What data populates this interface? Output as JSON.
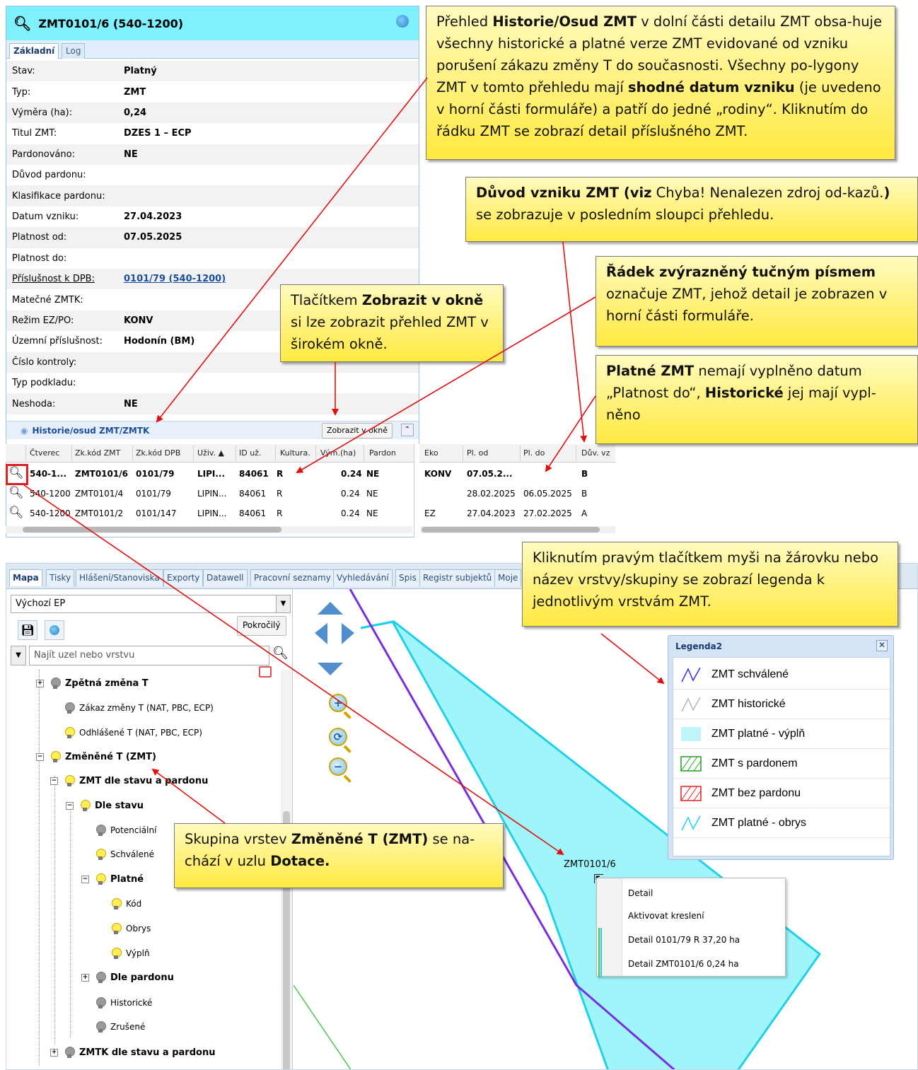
{
  "detail": {
    "title": "ZMT0101/6 (540-1200)",
    "tabs": [
      "Základní",
      "Log"
    ],
    "fields": [
      {
        "label": "Stav:",
        "value": "Platný"
      },
      {
        "label": "Typ:",
        "value": "ZMT"
      },
      {
        "label": "Výměra (ha):",
        "value": "0,24"
      },
      {
        "label": "Titul ZMT:",
        "value": "DZES 1 – ECP"
      },
      {
        "label": "Pardonováno:",
        "value": "NE"
      },
      {
        "label": "Důvod pardonu:",
        "value": ""
      },
      {
        "label": "Klasifikace pardonu:",
        "value": ""
      },
      {
        "label": "Datum vzniku:",
        "value": "27.04.2023"
      },
      {
        "label": "Platnost od:",
        "value": "07.05.2025"
      },
      {
        "label": "Platnost do:",
        "value": ""
      },
      {
        "label": "Příslušnost k DPB:",
        "value": "0101/79 (540-1200)"
      },
      {
        "label": "Matečné ZMTK:",
        "value": ""
      },
      {
        "label": "Režim EZ/PO:",
        "value": "KONV"
      },
      {
        "label": "Územní příslušnost:",
        "value": "Hodonín (BM)"
      },
      {
        "label": "Číslo kontroly:",
        "value": ""
      },
      {
        "label": "Typ podkladu:",
        "value": ""
      },
      {
        "label": "Neshoda:",
        "value": "NE"
      }
    ],
    "history_title": "Historie/osud ZMT/ZMTK",
    "window_button": "Zobrazit v okně"
  },
  "grid": {
    "headers": [
      "Čtverec",
      "Zk.kód ZMT",
      "Zk.kód DPB",
      "Uživ. ▲",
      "ID už.",
      "Kultura.",
      "Vým.(ha)",
      "Pardon",
      "Eko",
      "Pl. od",
      "Pl. do",
      "Dův. vz"
    ],
    "rows": [
      {
        "ctverec": "540-1...",
        "zmt": "ZMT0101/6",
        "dpb": "0101/79",
        "uziv": "LIPI...",
        "id": "84061",
        "kultura": "R",
        "vym": "0.24",
        "pardon": "NE",
        "eko": "KONV",
        "od": "07.05.2...",
        "do": "",
        "duv": "B",
        "bold": true
      },
      {
        "ctverec": "540-1200",
        "zmt": "ZMT0101/4",
        "dpb": "0101/79",
        "uziv": "LIPIN...",
        "id": "84061",
        "kultura": "R",
        "vym": "0.24",
        "pardon": "NE",
        "eko": "",
        "od": "28.02.2025",
        "do": "06.05.2025",
        "duv": "B",
        "bold": false
      },
      {
        "ctverec": "540-1200",
        "zmt": "ZMT0101/2",
        "dpb": "0101/147",
        "uziv": "LIPIN...",
        "id": "84061",
        "kultura": "R",
        "vym": "0.24",
        "pardon": "NE",
        "eko": "EZ",
        "od": "27.04.2023",
        "do": "27.02.2025",
        "duv": "A",
        "bold": false
      }
    ]
  },
  "app": {
    "tabs": [
      "Mapa",
      "Tisky",
      "Hlášení/Stanoviska",
      "Exporty",
      "Datawell",
      "Pracovní seznamy",
      "Vyhledávání",
      "Spis",
      "Registr subjektů",
      "Moje"
    ],
    "ep_select": "Výchozí EP",
    "advanced_button": "Pokročilý",
    "search_placeholder": "Najít uzel nebo vrstvu",
    "tree": [
      {
        "label": "Zpětná změna T",
        "bold": true,
        "bulb": "off",
        "expander": "+"
      },
      {
        "label": "Zákaz změny T (NAT, PBC, ECP)",
        "bold": false,
        "bulb": "off",
        "expander": ""
      },
      {
        "label": "Odhlášené T (NAT, PBC, ECP)",
        "bold": false,
        "bulb": "on",
        "expander": ""
      },
      {
        "label": "Změněné T (ZMT)",
        "bold": true,
        "bulb": "on",
        "expander": "−"
      },
      {
        "label": "ZMT dle stavu a pardonu",
        "bold": true,
        "bulb": "on",
        "expander": "−"
      },
      {
        "label": "Dle stavu",
        "bold": true,
        "bulb": "on",
        "expander": "−"
      },
      {
        "label": "Potenciální",
        "bold": false,
        "bulb": "off",
        "expander": ""
      },
      {
        "label": "Schválené",
        "bold": false,
        "bulb": "on",
        "expander": ""
      },
      {
        "label": "Platné",
        "bold": true,
        "bulb": "on",
        "expander": "−"
      },
      {
        "label": "Kód",
        "bold": false,
        "bulb": "on",
        "expander": ""
      },
      {
        "label": "Obrys",
        "bold": false,
        "bulb": "on",
        "expander": ""
      },
      {
        "label": "Výplň",
        "bold": false,
        "bulb": "on",
        "expander": ""
      },
      {
        "label": "Dle pardonu",
        "bold": true,
        "bulb": "off",
        "expander": "+"
      },
      {
        "label": "Historické",
        "bold": false,
        "bulb": "off",
        "expander": ""
      },
      {
        "label": "Zrušené",
        "bold": false,
        "bulb": "off",
        "expander": ""
      },
      {
        "label": "ZMTK dle stavu a pardonu",
        "bold": true,
        "bulb": "off",
        "expander": "+"
      }
    ],
    "map_label": "ZMT0101/6",
    "context_menu": [
      "Detail",
      "Aktivovat kreslení",
      "Detail 0101/79 R 37,20 ha",
      "Detail ZMT0101/6 0,24 ha"
    ]
  },
  "legend": {
    "title": "Legenda2",
    "close": "✕",
    "items": [
      "ZMT schválené",
      "ZMT historické",
      "ZMT platné - výplň",
      "ZMT s pardonem",
      "ZMT bez pardonu",
      "ZMT platné - obrys"
    ]
  },
  "callouts": {
    "c1": {
      "p1": "Přehled ",
      "b1": "Historie/Osud ZMT",
      "p2": " v dolní části detailu ZMT obsa-huje všechny historické a platné verze ZMT evidované od vzniku porušení zákazu změny T do současnosti. Všechny po-lygony ZMT v tomto přehledu mají ",
      "b2": "shodné datum vzniku",
      "p3": " (je uvedeno v horní části formuláře) a patří do jedné „rodiny“. Kliknutím do řádku ZMT se zobrazí detail příslušného ZMT."
    },
    "c2": {
      "b1": "Důvod vzniku ZMT (viz",
      "p1": " Chyba! Nenalezen zdroj od-kazů.",
      "b2": ")",
      "p2": " se zobrazuje v posledním sloupci přehledu."
    },
    "c3": {
      "b1": "Řádek zvýrazněný tučným písmem",
      "p1": " označuje ZMT, jehož detail je zobrazen v horní části formuláře."
    },
    "c4": {
      "p1": "Tlačítkem ",
      "b1": "Zobrazit v okně",
      "p2": " si lze zobrazit přehled ZMT v širokém okně."
    },
    "c5": {
      "b1": "Platné ZMT",
      "p1": " nemají vyplněno datum „Platnost do“, ",
      "b2": "Historické",
      "p2": " jej mají vypl-něno"
    },
    "c6": {
      "p1": "Kliknutím pravým tlačítkem myši na žárovku nebo název vrstvy/skupiny se zobrazí legenda k jednotlivým vrstvám ZMT."
    },
    "c7": {
      "p1": "Skupina vrstev ",
      "b1": "Změněné T (ZMT)",
      "p2": " se na-chází v uzlu ",
      "b2": "Dotace."
    }
  },
  "colors": {
    "header_cyan": "#7ff1fd",
    "polygon_fill": "#9ff5fa",
    "polygon_outline": "#20d0e8",
    "approved_line": "#7a2ce0",
    "arrow_red": "#e01010",
    "callout_yellow": "#ffe940"
  }
}
